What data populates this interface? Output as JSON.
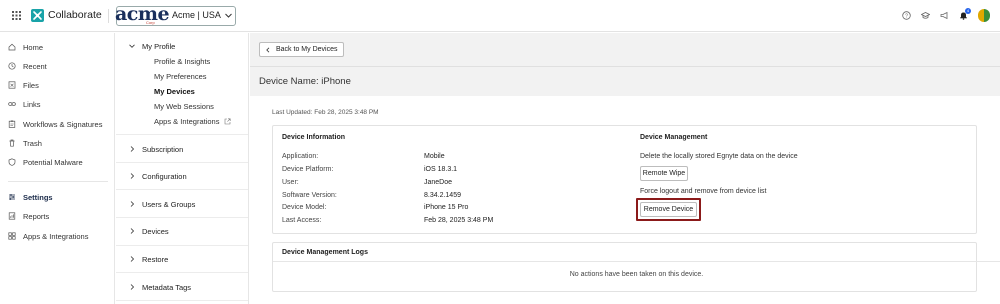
{
  "topbar": {
    "app_name": "Collaborate",
    "acme_logo_text": "acme",
    "acme_logo_subtext": "Corp",
    "tenant_label": "Acme | USA",
    "notification_count": "4"
  },
  "leftnav": {
    "items": [
      {
        "label": "Home",
        "icon": "home-icon"
      },
      {
        "label": "Recent",
        "icon": "clock-icon"
      },
      {
        "label": "Files",
        "icon": "files-icon"
      },
      {
        "label": "Links",
        "icon": "link-icon"
      },
      {
        "label": "Workflows & Signatures",
        "icon": "clipboard-icon"
      },
      {
        "label": "Trash",
        "icon": "trash-icon"
      },
      {
        "label": "Potential Malware",
        "icon": "shield-icon"
      }
    ],
    "lower_items": [
      {
        "label": "Settings",
        "icon": "sliders-icon",
        "active": true
      },
      {
        "label": "Reports",
        "icon": "report-icon"
      },
      {
        "label": "Apps & Integrations",
        "icon": "apps-icon"
      }
    ]
  },
  "settings_panel": {
    "my_profile": {
      "label": "My Profile",
      "children": [
        "Profile & Insights",
        "My Preferences",
        "My Devices",
        "My Web Sessions",
        "Apps & Integrations"
      ],
      "active_child": "My Devices"
    },
    "sections": [
      "Subscription",
      "Configuration",
      "Users & Groups",
      "Devices",
      "Restore",
      "Metadata Tags"
    ]
  },
  "main": {
    "back_label": "Back to My Devices",
    "device_name": "Device Name: iPhone",
    "last_updated": "Last Updated: Feb 28, 2025 3:48 PM",
    "device_info": {
      "title": "Device Information",
      "rows": [
        {
          "label": "Application:",
          "value": "Mobile"
        },
        {
          "label": "Device Platform:",
          "value": "iOS 18.3.1"
        },
        {
          "label": "User:",
          "value": "JaneDoe"
        },
        {
          "label": "Software Version:",
          "value": "8.34.2.1459"
        },
        {
          "label": "Device Model:",
          "value": "iPhone 15 Pro"
        },
        {
          "label": "Last Access:",
          "value": "Feb 28, 2025 3:48 PM"
        }
      ]
    },
    "device_management": {
      "title": "Device Management",
      "wipe_text": "Delete the locally stored Egnyte data on the device",
      "wipe_button": "Remote Wipe",
      "remove_text": "Force logout and remove from device list",
      "remove_button": "Remove Device"
    },
    "logs": {
      "title": "Device Management Logs",
      "empty_text": "No actions have been taken on this device."
    }
  },
  "colors": {
    "brand_teal": "#19a3a8",
    "highlight_red": "#8b1a1a",
    "notification_blue": "#2563eb"
  }
}
